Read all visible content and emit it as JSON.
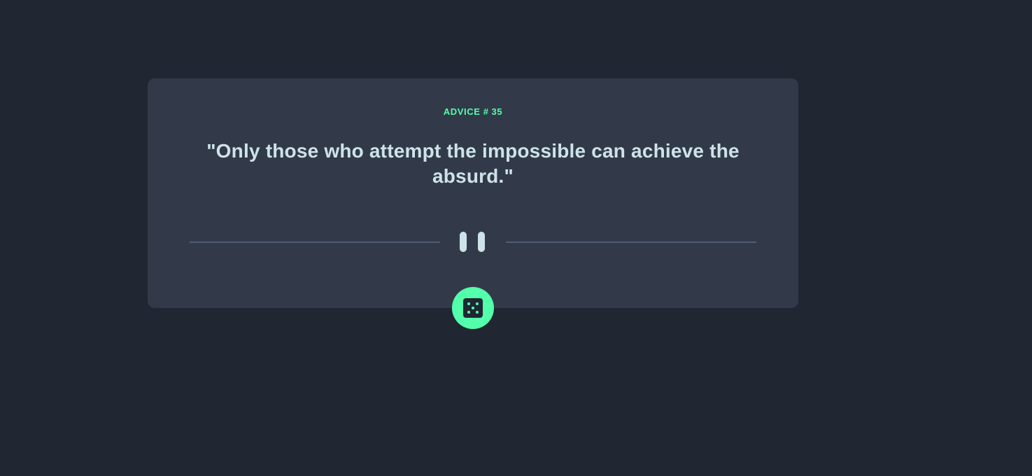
{
  "advice": {
    "label": "ADVICE #",
    "number": "35",
    "text": "\"Only those who attempt the impossible can achieve the absurd.\""
  },
  "divider": {
    "icon": "pause-icon"
  },
  "dice_button": {
    "icon": "dice-icon"
  },
  "colors": {
    "background": "#202632",
    "card": "#323A49",
    "accent": "#53FFAA",
    "quote_text": "#CEE3E9",
    "divider_line": "#4F5D74"
  }
}
